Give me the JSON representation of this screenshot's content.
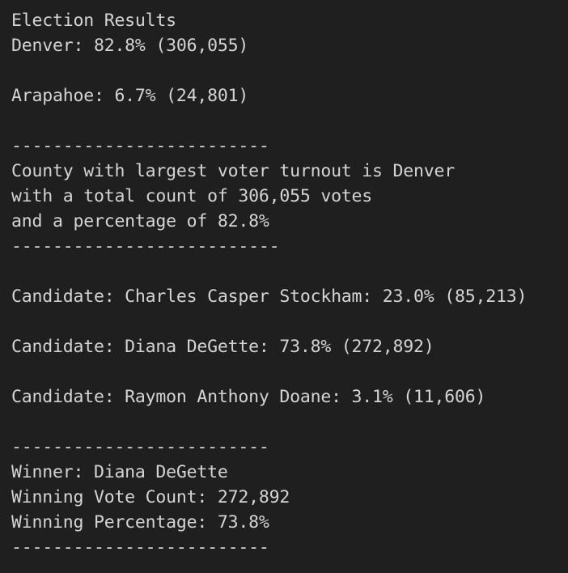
{
  "lines": [
    "Election Results",
    "Denver: 82.8% (306,055)",
    "",
    "Arapahoe: 6.7% (24,801)",
    "",
    "-------------------------",
    "County with largest voter turnout is Denver",
    "with a total count of 306,055 votes",
    "and a percentage of 82.8%",
    "--------------------------",
    "",
    "Candidate: Charles Casper Stockham: 23.0% (85,213)",
    "",
    "Candidate: Diana DeGette: 73.8% (272,892)",
    "",
    "Candidate: Raymon Anthony Doane: 3.1% (11,606)",
    "",
    "-------------------------",
    "Winner: Diana DeGette",
    "Winning Vote Count: 272,892",
    "Winning Percentage: 73.8%",
    "-------------------------"
  ],
  "colors": {
    "background": "#1f1f1f",
    "text": "#d4d4d4"
  }
}
